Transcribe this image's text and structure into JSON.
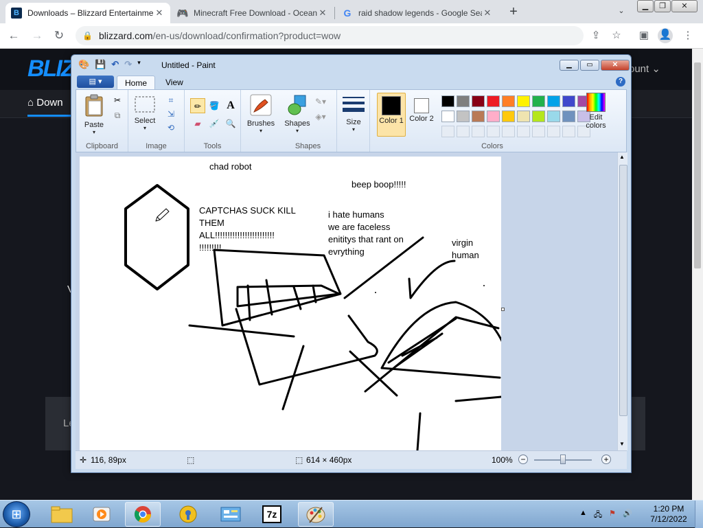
{
  "browser": {
    "tabs": [
      {
        "title": "Downloads – Blizzard Entertainment",
        "active": true
      },
      {
        "title": "Minecraft Free Download - OceanofGames",
        "active": false
      },
      {
        "title": "raid shadow legends - Google Search",
        "active": false
      }
    ],
    "url_host": "blizzard.com",
    "url_path": "/en-us/download/confirmation?product=wow"
  },
  "page": {
    "logo": "BLIZZARD",
    "account_label": "ount",
    "subnav_item": "Down",
    "partial_text_v": "V",
    "partial_text_l": "Le"
  },
  "paint": {
    "title": "Untitled - Paint",
    "tabs": {
      "home": "Home",
      "view": "View"
    },
    "groups": {
      "clipboard": "Clipboard",
      "image": "Image",
      "tools": "Tools",
      "shapes": "Shapes",
      "colors": "Colors"
    },
    "buttons": {
      "paste": "Paste",
      "select": "Select",
      "brushes": "Brushes",
      "shapes": "Shapes",
      "size": "Size",
      "color1": "Color 1",
      "color2": "Color 2",
      "edit_colors": "Edit colors"
    },
    "palette_row1": [
      "#000000",
      "#7f7f7f",
      "#880015",
      "#ed1c24",
      "#ff7f27",
      "#fff200",
      "#22b14c",
      "#00a2e8",
      "#3f48cc",
      "#a349a4"
    ],
    "palette_row2": [
      "#ffffff",
      "#c3c3c3",
      "#b97a57",
      "#ffaec9",
      "#ffc90e",
      "#efe4b0",
      "#b5e61d",
      "#99d9ea",
      "#7092be",
      "#c8bfe7"
    ],
    "color1": "#000000",
    "color2": "#ffffff",
    "canvas_texts": {
      "chad": "chad robot",
      "beep": "beep boop!!!!!",
      "captchas": "CAPTCHAS SUCK KILL\nTHEM\nALL!!!!!!!!!!!!!!!!!!!!!!!!\n!!!!!!!!!",
      "hate": "i hate humans\nwe are faceless\nenititys that rant on\nevrything",
      "virgin": "virgin\nhuman"
    },
    "status": {
      "cursor_pos": "116, 89px",
      "canvas_size": "614 × 460px",
      "zoom": "100%"
    }
  },
  "taskbar": {
    "time": "1:20 PM",
    "date": "7/12/2022"
  }
}
